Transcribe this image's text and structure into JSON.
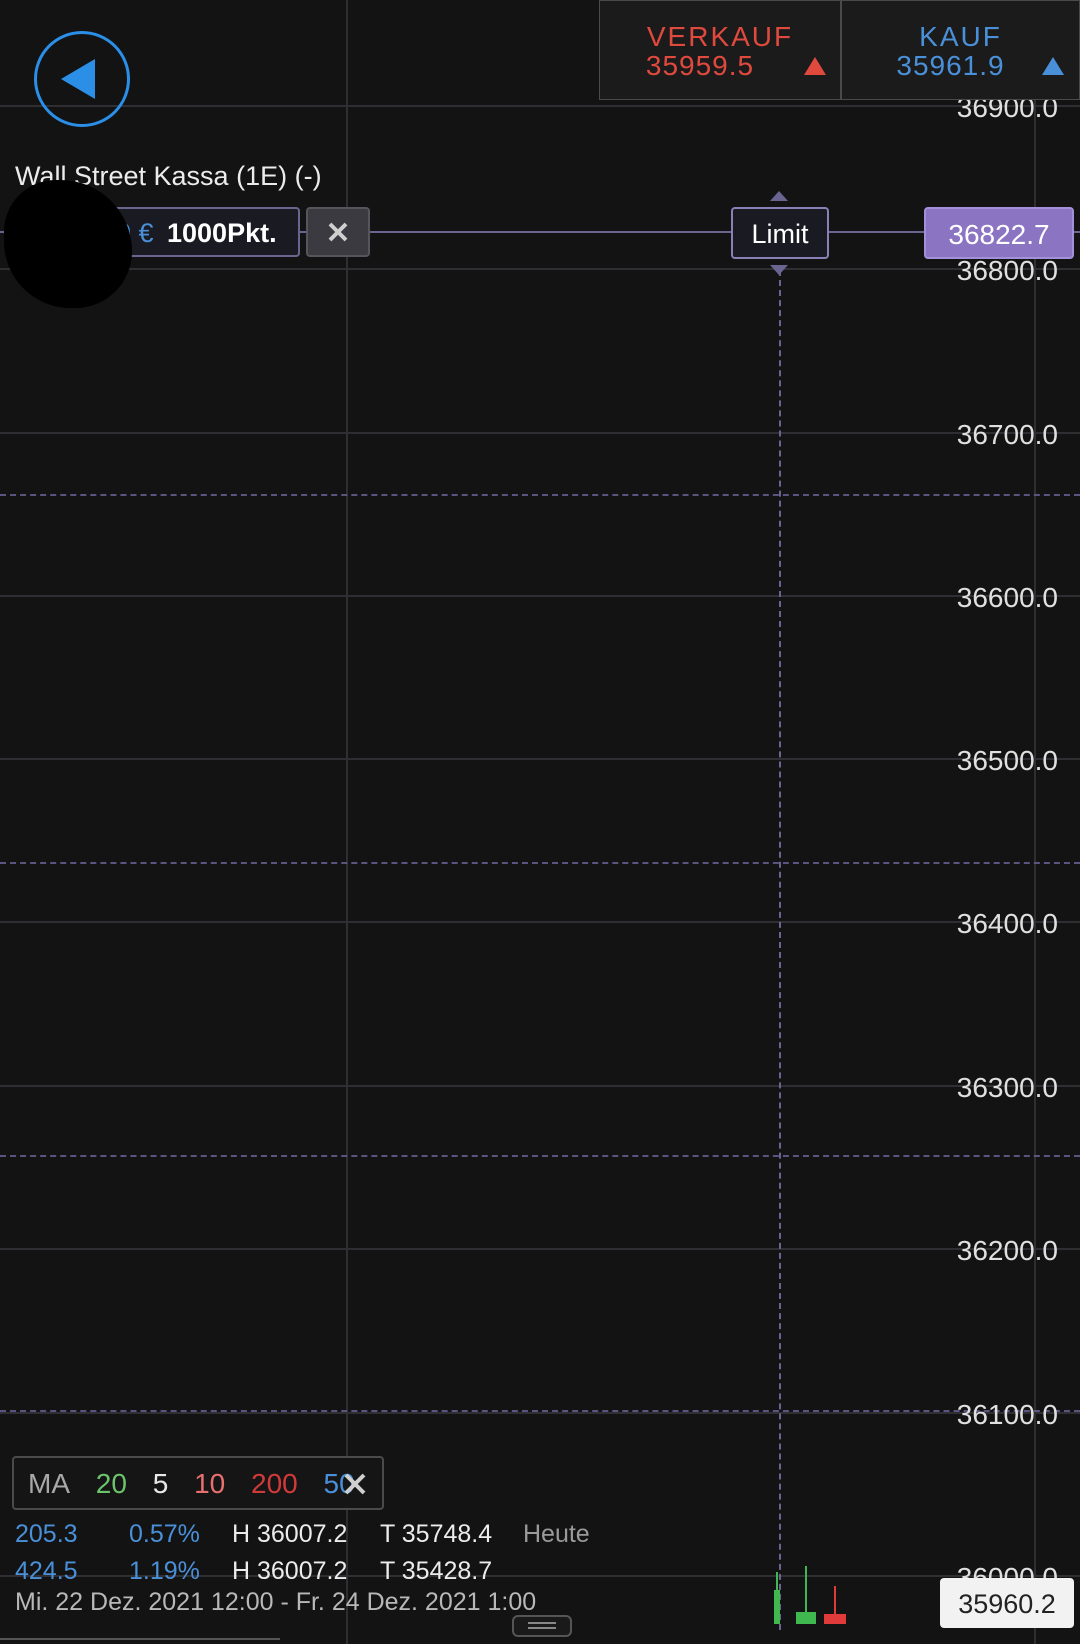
{
  "header": {
    "sell": {
      "label": "VERKAUF",
      "price": "35959.5",
      "color": "#e0493d"
    },
    "buy": {
      "label": "KAUF",
      "price": "35961.9",
      "color": "#4a90d9"
    }
  },
  "instrument": {
    "title": "Wall Street Kassa (1E) (-)"
  },
  "order": {
    "amount_label": "0 €",
    "distance_label": "1000Pkt.",
    "type_label": "Limit",
    "limit_price": "36822.7"
  },
  "y_axis": {
    "labels": [
      "36900.0",
      "36800.0",
      "36700.0",
      "36600.0",
      "36500.0",
      "36400.0",
      "36300.0",
      "36200.0",
      "36100.0",
      "36000.0"
    ]
  },
  "current_price": "35960.2",
  "indicators": {
    "label": "MA",
    "periods": [
      {
        "value": "20",
        "color": "#6bc46b"
      },
      {
        "value": "5",
        "color": "#e8e8e8"
      },
      {
        "value": "10",
        "color": "#e87070"
      },
      {
        "value": "200",
        "color": "#d03a3a"
      },
      {
        "value": "50",
        "color": "#4a90d9"
      }
    ]
  },
  "stats": [
    {
      "change": "205.3",
      "percent": "0.57%",
      "high": "H 36007.2",
      "low": "T 35748.4",
      "period": "Heute"
    },
    {
      "change": "424.5",
      "percent": "1.19%",
      "high": "H 36007.2",
      "low": "T 35428.7",
      "period": ""
    }
  ],
  "date_range": "Mi. 22 Dez. 2021 12:00 - Fr. 24 Dez. 2021 1:00",
  "icons": {
    "back": "back-arrow-icon",
    "close": "close-icon",
    "drag": "drag-handle-icon"
  }
}
